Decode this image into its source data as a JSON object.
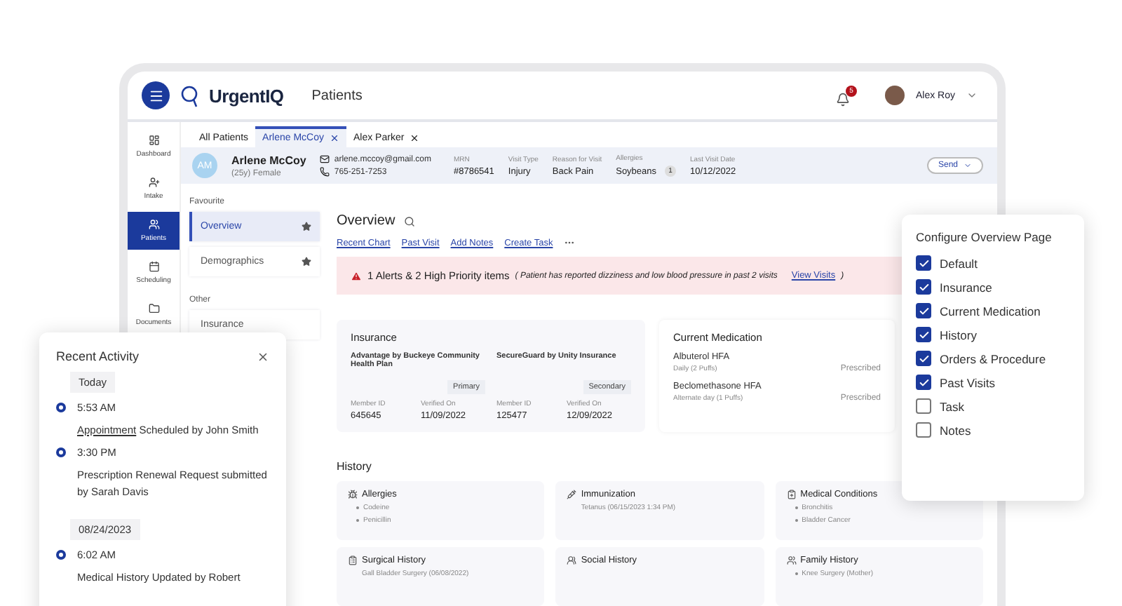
{
  "topbar": {
    "brand": "UrgentIQ",
    "page": "Patients",
    "notifications": "5",
    "user": "Alex Roy"
  },
  "nav": [
    {
      "label": "Dashboard",
      "selected": false
    },
    {
      "label": "Intake",
      "selected": false
    },
    {
      "label": "Patients",
      "selected": true
    },
    {
      "label": "Scheduling",
      "selected": false
    },
    {
      "label": "Documents",
      "selected": false
    }
  ],
  "tabs": [
    {
      "label": "All Patients",
      "selected": false,
      "closable": false
    },
    {
      "label": "Arlene McCoy",
      "selected": true,
      "closable": true
    },
    {
      "label": "Alex Parker",
      "selected": false,
      "closable": true
    }
  ],
  "patient": {
    "initials": "AM",
    "name": "Arlene McCoy",
    "info": "(25y) Female",
    "email": "arlene.mccoy@gmail.com",
    "phone": "765-251-7253",
    "fields": [
      {
        "label": "MRN",
        "value": "#8786541"
      },
      {
        "label": "Visit Type",
        "value": "Injury"
      },
      {
        "label": "Reason for Visit",
        "value": "Back Pain"
      },
      {
        "label": "Allergies",
        "value": "Soybeans",
        "badge": "1"
      },
      {
        "label": "Last Visit Date",
        "value": "10/12/2022"
      }
    ],
    "send": "Send"
  },
  "sidebar": {
    "groups": [
      {
        "title": "Favourite",
        "items": [
          {
            "label": "Overview",
            "selected": true,
            "starred": true
          },
          {
            "label": "Demographics",
            "selected": false,
            "starred": true
          }
        ]
      },
      {
        "title": "Other",
        "items": [
          {
            "label": "Insurance",
            "selected": false,
            "starred": false
          }
        ]
      }
    ]
  },
  "overview": {
    "title": "Overview",
    "links": [
      "Recent Chart",
      "Past Visit",
      "Add Notes",
      "Create Task"
    ],
    "alert": {
      "title": "1 Alerts & 2 High Priority items",
      "note": "( Patient has reported dizziness and low blood pressure in past 2 visits",
      "link": "View Visits",
      "end": ")"
    },
    "insurance": {
      "title": "Insurance",
      "plans": [
        {
          "name": "Advantage by Buckeye Community Health Plan",
          "rank": "Primary",
          "id_label": "Member ID",
          "id": "645645",
          "verified_label": "Verified On",
          "verified": "11/09/2022"
        },
        {
          "name": "SecureGuard by Unity Insurance",
          "rank": "Secondary",
          "id_label": "Member ID",
          "id": "125477",
          "verified_label": "Verified On",
          "verified": "12/09/2022"
        }
      ]
    },
    "medication": {
      "title": "Current Medication",
      "items": [
        {
          "name": "Albuterol HFA",
          "sig": "Daily (2 Puffs)",
          "status": "Prescribed"
        },
        {
          "name": "Beclomethasone HFA",
          "sig": "Alternate day (1 Puffs)",
          "status": "Prescribed"
        }
      ]
    },
    "history": {
      "title": "History",
      "cards": [
        {
          "title": "Allergies",
          "kind": "bullets",
          "items": [
            "Codeine",
            "Penicillin"
          ]
        },
        {
          "title": "Immunization",
          "kind": "plain",
          "items": [
            "Tetanus (06/15/2023 1:34 PM)"
          ]
        },
        {
          "title": "Medical Conditions",
          "kind": "bullets",
          "items": [
            "Bronchitis",
            "Bladder Cancer"
          ]
        },
        {
          "title": "Surgical History",
          "kind": "plain",
          "items": [
            "Gall Bladder Surgery (06/08/2022)"
          ]
        },
        {
          "title": "Social History"
        },
        {
          "title": "Family History",
          "kind": "bullets",
          "items": [
            "Knee Surgery (Mother)"
          ]
        }
      ]
    }
  },
  "configure": {
    "title": "Configure Overview Page",
    "options": [
      {
        "label": "Default",
        "checked": true
      },
      {
        "label": "Insurance",
        "checked": true
      },
      {
        "label": "Current Medication",
        "checked": true
      },
      {
        "label": "History",
        "checked": true
      },
      {
        "label": "Orders & Procedure",
        "checked": true
      },
      {
        "label": "Past Visits",
        "checked": true
      },
      {
        "label": "Task",
        "checked": false
      },
      {
        "label": "Notes",
        "checked": false
      }
    ]
  },
  "recent_activity": {
    "title": "Recent Activity",
    "groups": [
      {
        "date": "Today",
        "entries": [
          {
            "time": "5:53 AM",
            "link": "Appointment",
            "text": "Scheduled by John Smith"
          },
          {
            "time": "3:30 PM",
            "text": "Prescription Renewal Request submitted by Sarah Davis"
          }
        ]
      },
      {
        "date": "08/24/2023",
        "entries": [
          {
            "time": "6:02 AM",
            "text": "Medical History Updated by Robert"
          }
        ]
      }
    ]
  }
}
